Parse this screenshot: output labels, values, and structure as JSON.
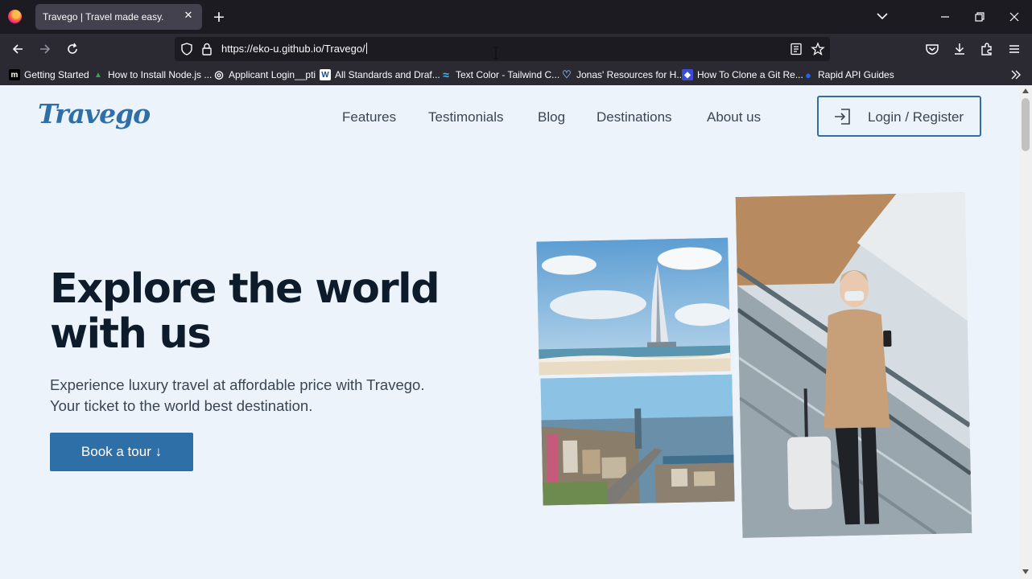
{
  "browser": {
    "tab_title": "Travego | Travel made easy.",
    "url": "https://eko-u.github.io/Travego/",
    "bookmarks": [
      {
        "label": "Getting Started",
        "icon": "medium-icon",
        "glyph": "m",
        "color": "#000000"
      },
      {
        "label": "How to Install Node.js ...",
        "icon": "google-drive-icon",
        "glyph": "▲",
        "color": "#34a853"
      },
      {
        "label": "Applicant Login__pti",
        "icon": "globe-icon",
        "glyph": "◎",
        "color": "#fbfbfe"
      },
      {
        "label": "All Standards and Draf...",
        "icon": "w3c-icon",
        "glyph": "W",
        "color": "#ffffff"
      },
      {
        "label": "Text Color - Tailwind C...",
        "icon": "tailwind-icon",
        "glyph": "≈",
        "color": "#38bdf8"
      },
      {
        "label": "Jonas' Resources for H...",
        "icon": "heart-icon",
        "glyph": "♡",
        "color": "#7fb3e6"
      },
      {
        "label": "How To Clone a Git Re...",
        "icon": "git-article-icon",
        "glyph": "◆",
        "color": "#5a6cf0"
      },
      {
        "label": "Rapid API Guides",
        "icon": "rapidapi-icon",
        "glyph": "●",
        "color": "#2563eb"
      }
    ]
  },
  "site": {
    "logo": "Travego",
    "nav": [
      "Features",
      "Testimonials",
      "Blog",
      "Destinations",
      "About us"
    ],
    "login_label": "Login / Register",
    "hero": {
      "title_line1": "Explore the world",
      "title_line2": "with us",
      "subtitle_line1": "Experience luxury travel at affordable price with Travego.",
      "subtitle_line2": "Your ticket to the world best destination.",
      "cta_label": "Book a tour ↓"
    },
    "colors": {
      "brand": "#2f6fa8",
      "heading": "#0d1b2a",
      "background": "#ecf3fb"
    }
  }
}
